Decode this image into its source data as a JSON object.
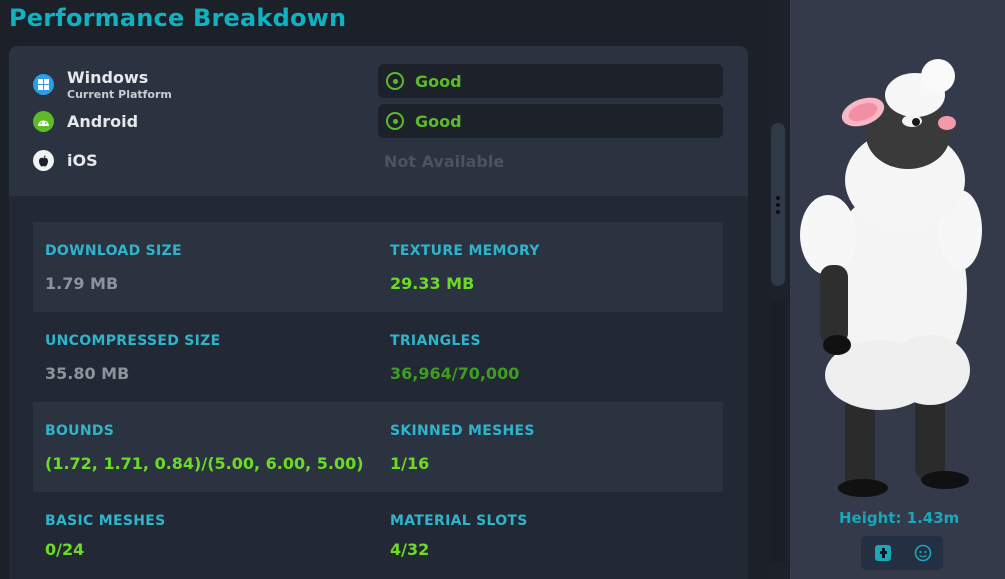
{
  "header": {
    "title": "Performance Breakdown"
  },
  "platforms": [
    {
      "name": "Windows",
      "sub": "Current Platform",
      "status": "Good",
      "icon": "windows-icon"
    },
    {
      "name": "Android",
      "sub": "",
      "status": "Good",
      "icon": "android-icon"
    },
    {
      "name": "iOS",
      "sub": "",
      "status": "Not Available",
      "icon": "apple-icon"
    }
  ],
  "stats": {
    "download_size": {
      "label": "DOWNLOAD SIZE",
      "value": "1.79 MB"
    },
    "texture_memory": {
      "label": "TEXTURE MEMORY",
      "value": "29.33 MB"
    },
    "uncompressed_size": {
      "label": "UNCOMPRESSED SIZE",
      "value": "35.80 MB"
    },
    "triangles": {
      "label": "TRIANGLES",
      "value": "36,964/70,000"
    },
    "bounds": {
      "label": "BOUNDS",
      "value": "(1.72, 1.71, 0.84)/(5.00, 6.00, 5.00)"
    },
    "skinned_meshes": {
      "label": "SKINNED MESHES",
      "value": "1/16"
    },
    "basic_meshes": {
      "label": "BASIC MESHES",
      "value": "0/24"
    },
    "material_slots": {
      "label": "MATERIAL SLOTS",
      "value": "4/32"
    }
  },
  "avatar": {
    "height_text": "Height: 1.43m"
  },
  "colors": {
    "accent": "#0eb2c1",
    "good": "#5dbb2a",
    "stat_green": "#6cdb25",
    "stat_label": "#2fb4cc"
  }
}
